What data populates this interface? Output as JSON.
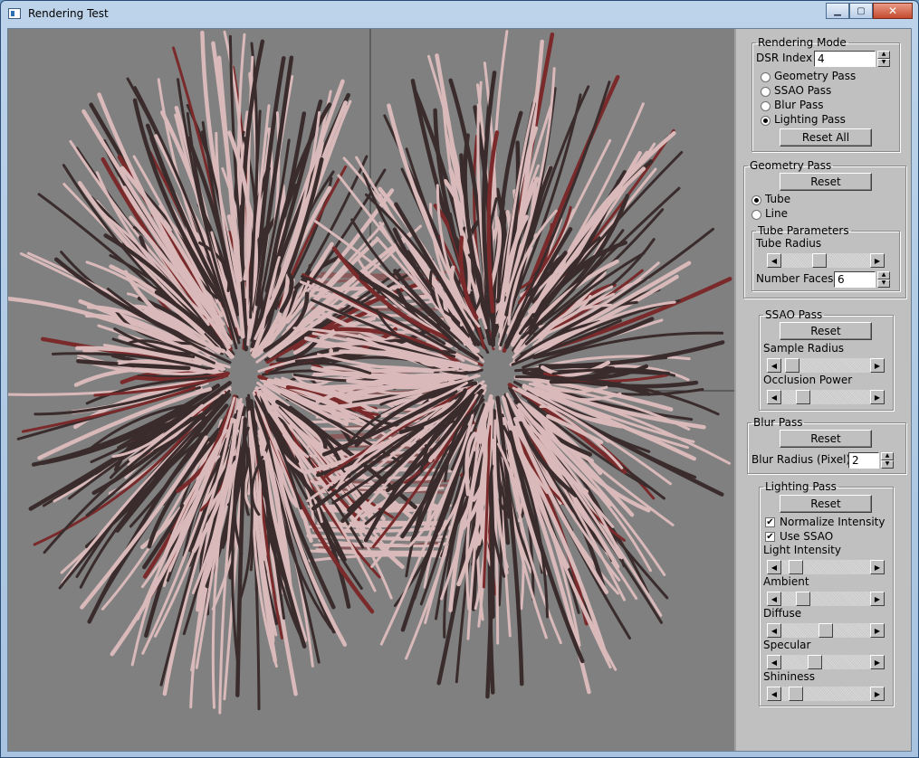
{
  "window": {
    "title": "Rendering Test",
    "minimize": "0",
    "maximize": "1",
    "close": "r"
  },
  "rendering_mode": {
    "legend": "Rendering Mode",
    "dsr_label": "DSR Index",
    "dsr_value": "4",
    "options": [
      {
        "label": "Geometry Pass",
        "selected": false
      },
      {
        "label": "SSAO Pass",
        "selected": false
      },
      {
        "label": "Blur Pass",
        "selected": false
      },
      {
        "label": "Lighting Pass",
        "selected": true
      }
    ],
    "reset_all": "Reset All"
  },
  "geometry_pass": {
    "legend": "Geometry Pass",
    "reset": "Reset",
    "tube": "Tube",
    "line": "Line",
    "tube_params_legend": "Tube Parameters",
    "tube_radius": "Tube Radius",
    "tube_radius_level": 0.42,
    "number_faces_label": "Number Faces",
    "number_faces_value": "6"
  },
  "ssao_pass": {
    "legend": "SSAO Pass",
    "reset": "Reset",
    "sample_radius": "Sample Radius",
    "sample_radius_level": 0.05,
    "occlusion_power": "Occlusion Power",
    "occlusion_power_level": 0.2
  },
  "blur_pass": {
    "legend": "Blur Pass",
    "reset": "Reset",
    "radius_label": "Blur Radius (Pixel)",
    "radius_value": "2"
  },
  "lighting_pass": {
    "legend": "Lighting Pass",
    "reset": "Reset",
    "normalize": "Normalize Intensity",
    "use_ssao": "Use SSAO",
    "sliders": [
      {
        "label": "Light Intensity",
        "level": 0.1
      },
      {
        "label": "Ambient",
        "level": 0.2
      },
      {
        "label": "Diffuse",
        "level": 0.5
      },
      {
        "label": "Specular",
        "level": 0.35
      },
      {
        "label": "Shininess",
        "level": 0.1
      }
    ]
  },
  "colors": {
    "viewport_bg": "#808080",
    "panel_bg": "#c0c0c0",
    "fiber_light": "#d9b9b9",
    "fiber_dark": "#3a2c2c"
  }
}
